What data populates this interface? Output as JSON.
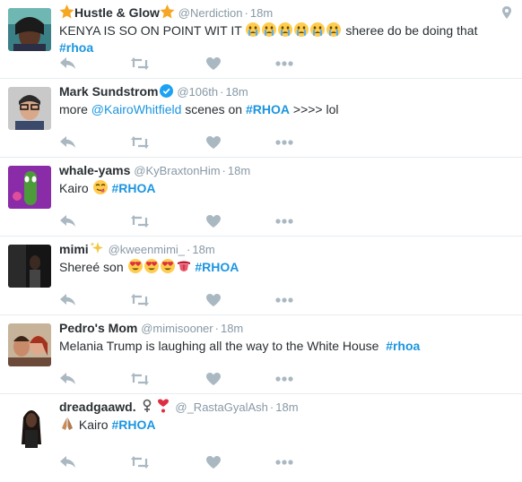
{
  "tweets": [
    {
      "name": "Hustle & Glow",
      "handle": "@Nerdiction",
      "time": "18m",
      "text_before": "KENYA IS SO ON POINT WIT IT",
      "text_after": "sheree do be doing that",
      "hashtag": "#rhoa",
      "emoji": [
        "crying-face-emoji",
        "crying-face-emoji",
        "crying-face-emoji",
        "crying-face-emoji",
        "crying-face-emoji",
        "crying-face-emoji"
      ],
      "has_location_icon": true
    },
    {
      "name": "Mark Sundstrom",
      "handle": "@106th",
      "time": "18m",
      "text_before": "more",
      "mention": "@KairoWhitfield",
      "text_mid": "scenes on",
      "hashtag": "#RHOA",
      "text_after": ">>>>  lol",
      "verified": true
    },
    {
      "name": "whale-yams",
      "handle": "@KyBraxtonHim",
      "time": "18m",
      "text_before": "Kairo",
      "hashtag": "#RHOA",
      "emoji": [
        "yum-face-emoji"
      ]
    },
    {
      "name": "mimi",
      "handle": "@kweenmimi_",
      "time": "18m",
      "text_before": "Shereé son",
      "hashtag": "#RHOA",
      "emoji": [
        "heart-eyes-emoji",
        "heart-eyes-emoji",
        "heart-eyes-emoji",
        "tongue-emoji"
      ]
    },
    {
      "name": "Pedro's Mom",
      "handle": "@mimisooner",
      "time": "18m",
      "text_before": "Melania Trump is laughing all the way to the White House",
      "hashtag": "#rhoa"
    },
    {
      "name": "dreadgaawd.",
      "handle": "@_RastaGyalAsh",
      "time": "18m",
      "text_before": "Kairo",
      "hashtag": "#RHOA",
      "emoji": [
        "praying-hands-emoji"
      ]
    }
  ],
  "colors": {
    "link": "#1b95e0",
    "text": "#292f33",
    "muted": "#8899a6",
    "action_icon": "#aab8c2",
    "divider": "#e6ecf0"
  }
}
